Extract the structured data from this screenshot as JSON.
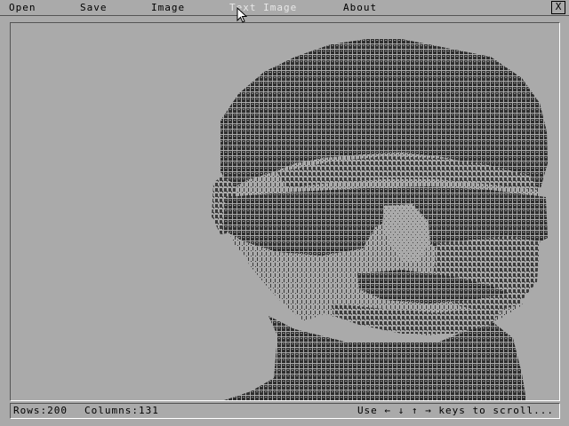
{
  "menu": {
    "open": "Open",
    "save": "Save",
    "image": "Image",
    "text_image": "Text Image",
    "about": "About",
    "close": "X"
  },
  "status": {
    "rows": "Rows:200",
    "columns": "Columns:131",
    "hint": "Use ← ↓ ↑ → keys to scroll..."
  },
  "colors": {
    "background": "#aaaaaa",
    "ascii_ink": "#2a2a2a"
  },
  "icons": {
    "cursor": "arrow-cursor-icon"
  }
}
